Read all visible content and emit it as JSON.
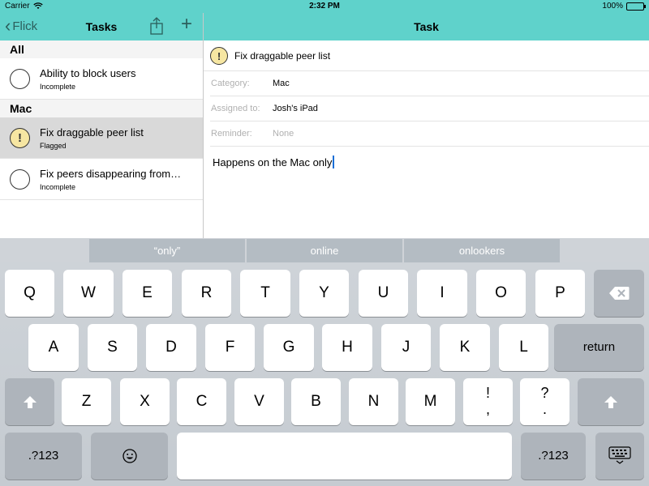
{
  "status": {
    "carrier": "Carrier",
    "time": "2:32 PM",
    "battery": "100%"
  },
  "left_nav": {
    "back_label": "Flick",
    "title": "Tasks"
  },
  "right_nav": {
    "title": "Task"
  },
  "sections": [
    {
      "title": "All",
      "tasks": [
        {
          "title": "Ability to block users",
          "status": "Incomplete"
        }
      ]
    },
    {
      "title": "Mac",
      "tasks": [
        {
          "title": "Fix draggable peer list",
          "status": "Flagged"
        },
        {
          "title": "Fix peers disappearing from…",
          "status": "Incomplete"
        }
      ]
    }
  ],
  "detail": {
    "title": "Fix draggable peer list",
    "category_label": "Category:",
    "category_value": "Mac",
    "assigned_label": "Assigned to:",
    "assigned_value": "Josh's iPad",
    "reminder_label": "Reminder:",
    "reminder_value": "None",
    "notes": "Happens on the Mac only"
  },
  "flag_glyph": "!",
  "keyboard": {
    "suggestions": [
      "“only”",
      "online",
      "onlookers"
    ],
    "row1": [
      "Q",
      "W",
      "E",
      "R",
      "T",
      "Y",
      "U",
      "I",
      "O",
      "P"
    ],
    "row2": [
      "A",
      "S",
      "D",
      "F",
      "G",
      "H",
      "J",
      "K",
      "L"
    ],
    "row3": [
      "Z",
      "X",
      "C",
      "V",
      "B",
      "N",
      "M"
    ],
    "return_label": "return",
    "numbers_label": ".?123",
    "punct_1": [
      "!",
      ","
    ],
    "punct_2": [
      "?",
      "."
    ]
  },
  "colors": {
    "header": "#5fd2cb",
    "accent": "#2b5f5c",
    "flag": "#f6e6a2"
  }
}
